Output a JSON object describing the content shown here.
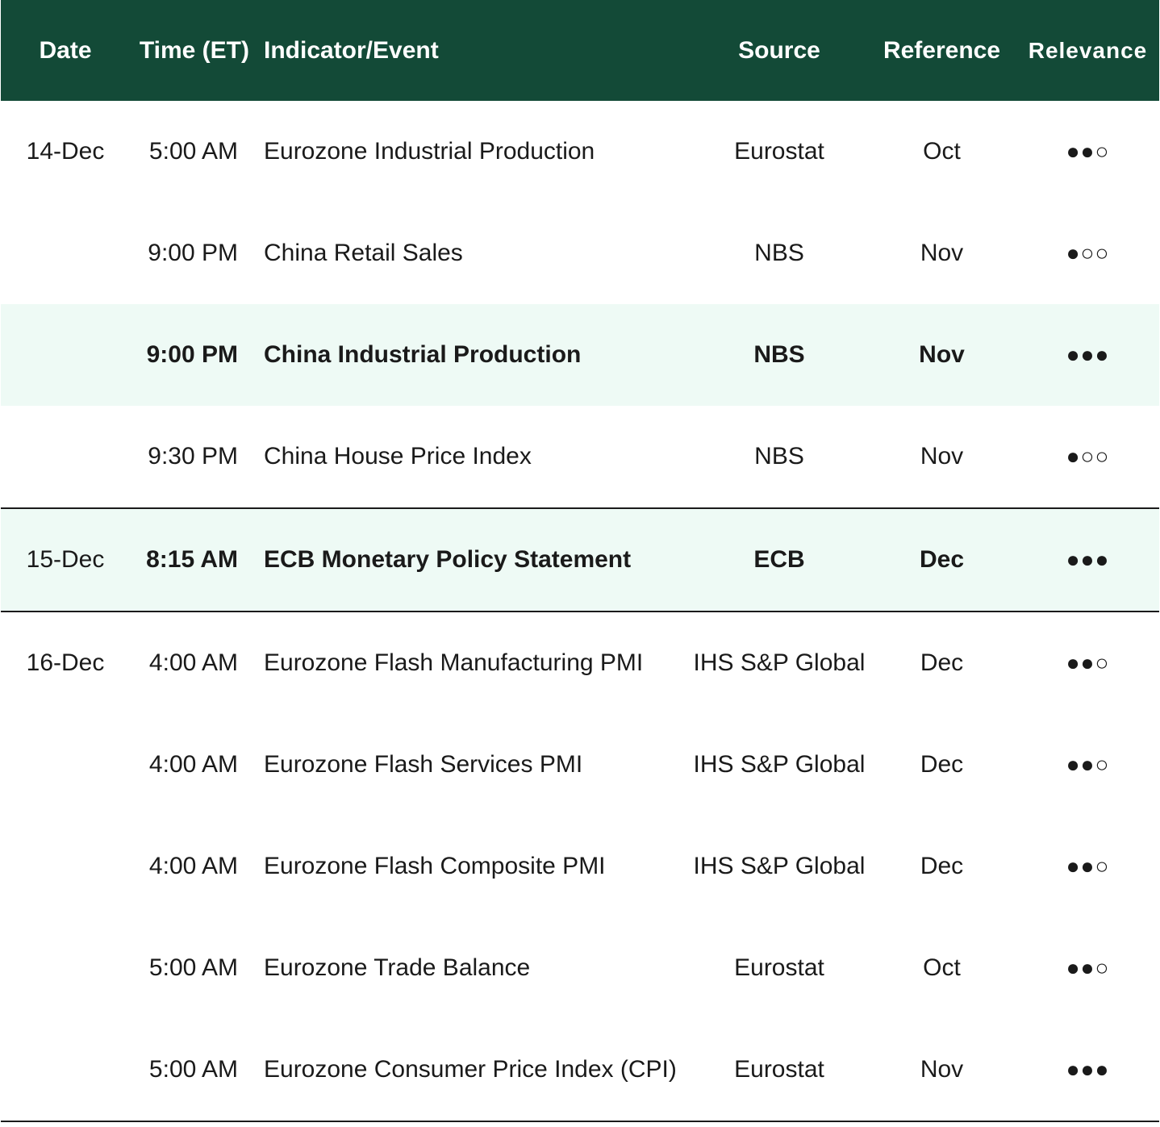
{
  "header": {
    "date": "Date",
    "time": "Time (ET)",
    "event": "Indicator/Event",
    "source": "Source",
    "reference": "Reference",
    "relevance": "Relevance"
  },
  "rows": [
    {
      "date": "14-Dec",
      "time": "5:00 AM",
      "event": "Eurozone Industrial Production",
      "source": "Eurostat",
      "reference": "Oct",
      "relevance": "●●○",
      "relevance_level": 2
    },
    {
      "date": "",
      "time": "9:00 PM",
      "event": "China Retail Sales",
      "source": "NBS",
      "reference": "Nov",
      "relevance": "●○○",
      "relevance_level": 1
    },
    {
      "date": "",
      "time": "9:00 PM",
      "event": "China Industrial Production",
      "source": "NBS",
      "reference": "Nov",
      "relevance": "●●●",
      "relevance_level": 3
    },
    {
      "date": "",
      "time": "9:30 PM",
      "event": "China House Price Index",
      "source": "NBS",
      "reference": "Nov",
      "relevance": "●○○",
      "relevance_level": 1
    },
    {
      "date": "15-Dec",
      "time": "8:15 AM",
      "event": "ECB Monetary Policy Statement",
      "source": "ECB",
      "reference": "Dec",
      "relevance": "●●●",
      "relevance_level": 3
    },
    {
      "date": "16-Dec",
      "time": "4:00 AM",
      "event": "Eurozone Flash Manufacturing PMI",
      "source": "IHS S&P Global",
      "reference": "Dec",
      "relevance": "●●○",
      "relevance_level": 2
    },
    {
      "date": "",
      "time": "4:00 AM",
      "event": "Eurozone Flash Services PMI",
      "source": "IHS S&P Global",
      "reference": "Dec",
      "relevance": "●●○",
      "relevance_level": 2
    },
    {
      "date": "",
      "time": "4:00 AM",
      "event": "Eurozone Flash Composite PMI",
      "source": "IHS S&P Global",
      "reference": "Dec",
      "relevance": "●●○",
      "relevance_level": 2
    },
    {
      "date": "",
      "time": "5:00 AM",
      "event": "Eurozone Trade Balance",
      "source": "Eurostat",
      "reference": "Oct",
      "relevance": "●●○",
      "relevance_level": 2
    },
    {
      "date": "",
      "time": "5:00 AM",
      "event": "Eurozone Consumer Price Index (CPI)",
      "source": "Eurostat",
      "reference": "Nov",
      "relevance": "●●●",
      "relevance_level": 3
    }
  ],
  "colors": {
    "header_bg": "#134a37",
    "highlight_bg": "#eefaf5"
  }
}
